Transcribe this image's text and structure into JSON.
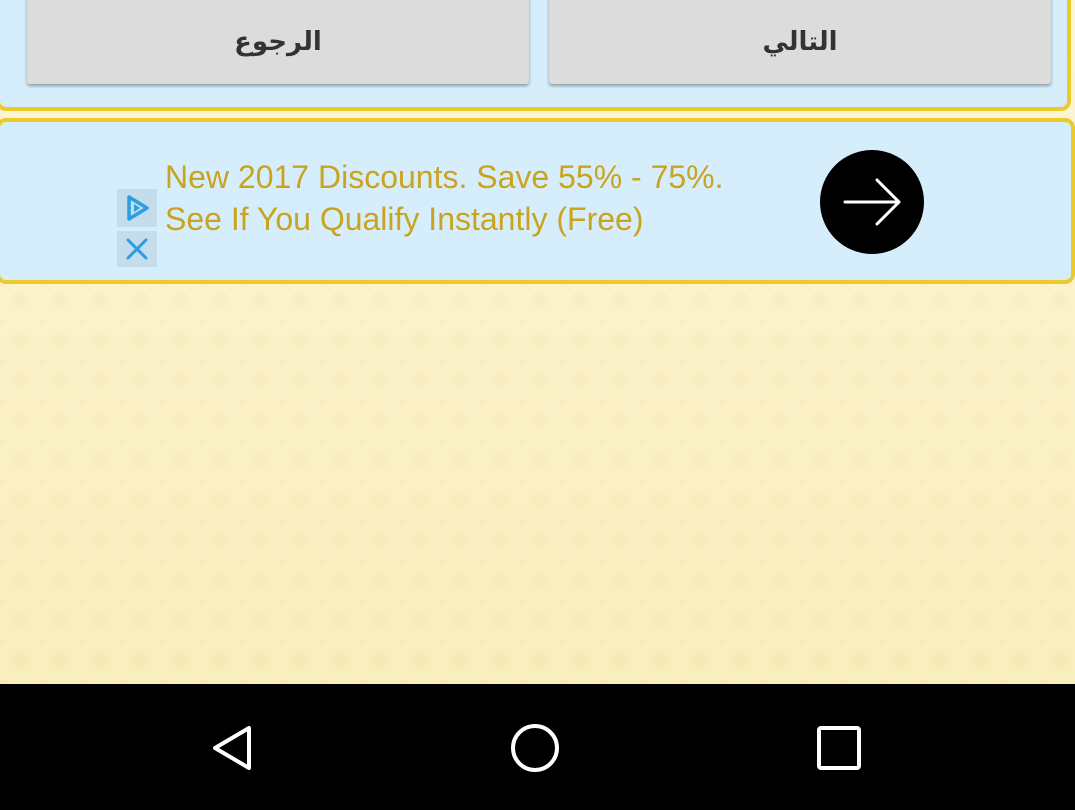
{
  "toolbar": {
    "back_label": "الرجوع",
    "next_label": "التالي"
  },
  "ad": {
    "line1": "New 2017 Discounts. Save 55% - 75%.",
    "line2": "See If You Qualify Instantly (Free)",
    "play_icon": "adchoices-play-icon",
    "close_icon": "close-icon",
    "arrow_icon": "arrow-right-icon",
    "text_color": "#caa31f",
    "background": "#d6eefb",
    "border_color": "#ecca2c"
  },
  "system_nav": {
    "back_icon": "back-triangle-icon",
    "home_icon": "home-circle-icon",
    "recents_icon": "recents-square-icon"
  }
}
